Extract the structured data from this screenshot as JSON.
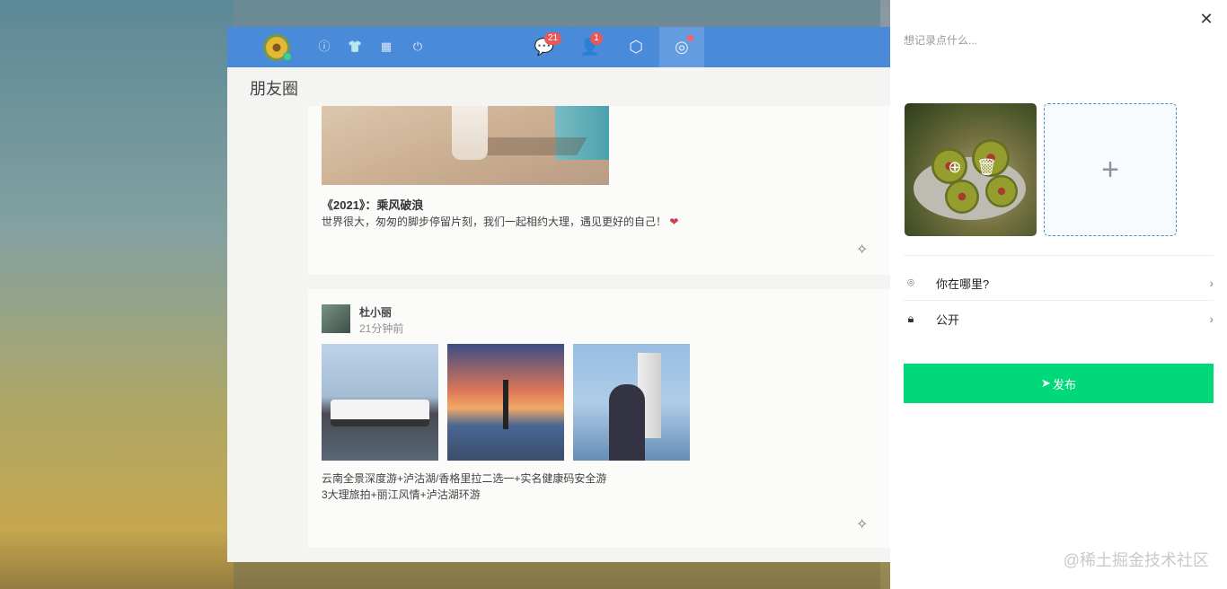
{
  "app": {
    "page_title": "朋友圈",
    "badges": {
      "messages": "21",
      "contacts": "1"
    }
  },
  "feed": [
    {
      "title": "《2021》：乘风破浪",
      "text": "世界很大，匆匆的脚步停留片刻，我们一起相约大理，遇见更好的自己！",
      "emoji": "❤"
    },
    {
      "username": "杜小丽",
      "time": "21分钟前",
      "desc_lines": [
        "云南全景深度游+泸沽湖/香格里拉二选一+实名健康码安全游",
        "3大理旅拍+丽江风情+泸沽湖环游"
      ]
    }
  ],
  "drawer": {
    "input_placeholder": "想记录点什么...",
    "location_label": "你在哪里?",
    "visibility_label": "公开",
    "publish_label": "发布",
    "close_glyph": "✕",
    "upload_glyph": "+"
  },
  "watermark": "@稀土掘金技术社区",
  "colors": {
    "topbar": "#3b82d6",
    "publish": "#00d87a",
    "badge": "#e84a4a"
  }
}
